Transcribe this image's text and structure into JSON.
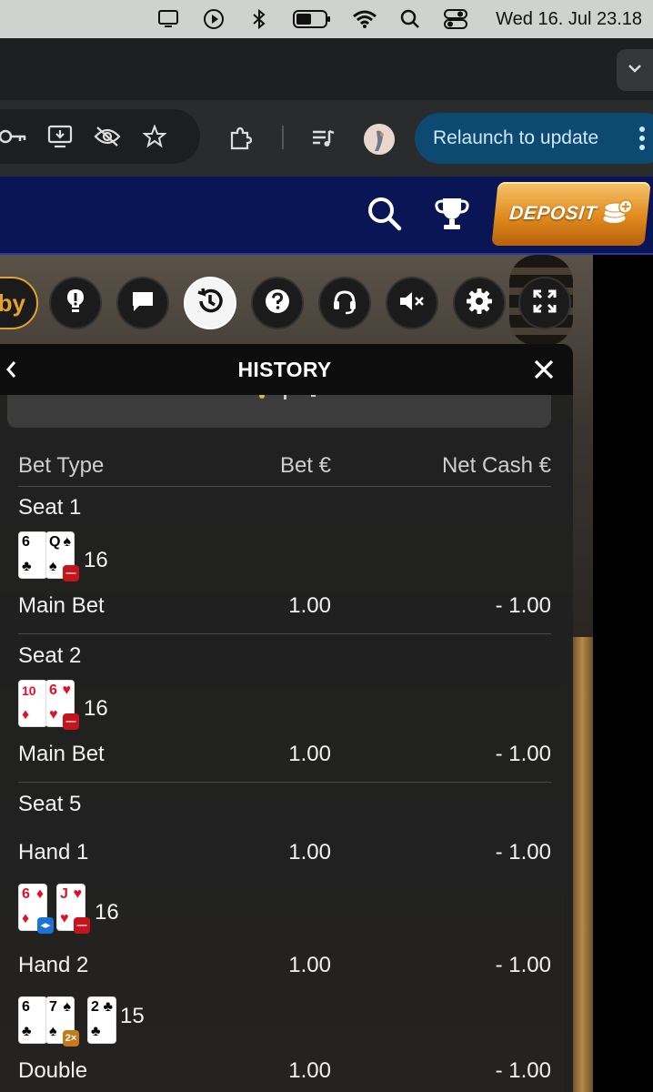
{
  "menubar": {
    "clock": "Wed 16. Jul  23.18",
    "icons": [
      "display-icon",
      "play-icon",
      "bluetooth-icon",
      "battery-icon",
      "wifi-icon",
      "spotlight-search-icon",
      "control-center-icon"
    ]
  },
  "browser": {
    "relaunch_label": "Relaunch to update"
  },
  "site": {
    "deposit_label": "DEPOSIT"
  },
  "game": {
    "lobby_fragment": "by"
  },
  "history": {
    "title": "HISTORY",
    "headers": {
      "bet_type": "Bet Type",
      "bet": "Bet €",
      "net": "Net Cash €"
    },
    "seat1": {
      "label": "Seat 1",
      "cards": [
        {
          "rank": "6",
          "suit": "♣",
          "red": false
        },
        {
          "rank": "Q",
          "suit": "♠",
          "red": false
        }
      ],
      "total": "16",
      "bet_label": "Main Bet",
      "bet": "1.00",
      "net": "- 1.00"
    },
    "seat2": {
      "label": "Seat 2",
      "cards": [
        {
          "rank": "10",
          "suit": "♦",
          "red": true
        },
        {
          "rank": "6",
          "suit": "♥",
          "red": true
        }
      ],
      "total": "16",
      "bet_label": "Main Bet",
      "bet": "1.00",
      "net": "- 1.00"
    },
    "seat5": {
      "label": "Seat 5",
      "hand1": {
        "label": "Hand 1",
        "bet": "1.00",
        "net": "- 1.00",
        "cards": [
          {
            "rank": "6",
            "suit": "♦",
            "red": true
          },
          {
            "rank": "J",
            "suit": "♥",
            "red": true
          }
        ],
        "total": "16"
      },
      "hand2": {
        "label": "Hand 2",
        "bet": "1.00",
        "net": "- 1.00",
        "cards": [
          {
            "rank": "6",
            "suit": "♣",
            "red": false
          },
          {
            "rank": "7",
            "suit": "♠",
            "red": false
          },
          {
            "rank": "2",
            "suit": "♣",
            "red": false
          }
        ],
        "total": "15"
      },
      "double": {
        "label": "Double",
        "bet": "1.00",
        "net": "- 1.00"
      }
    }
  }
}
